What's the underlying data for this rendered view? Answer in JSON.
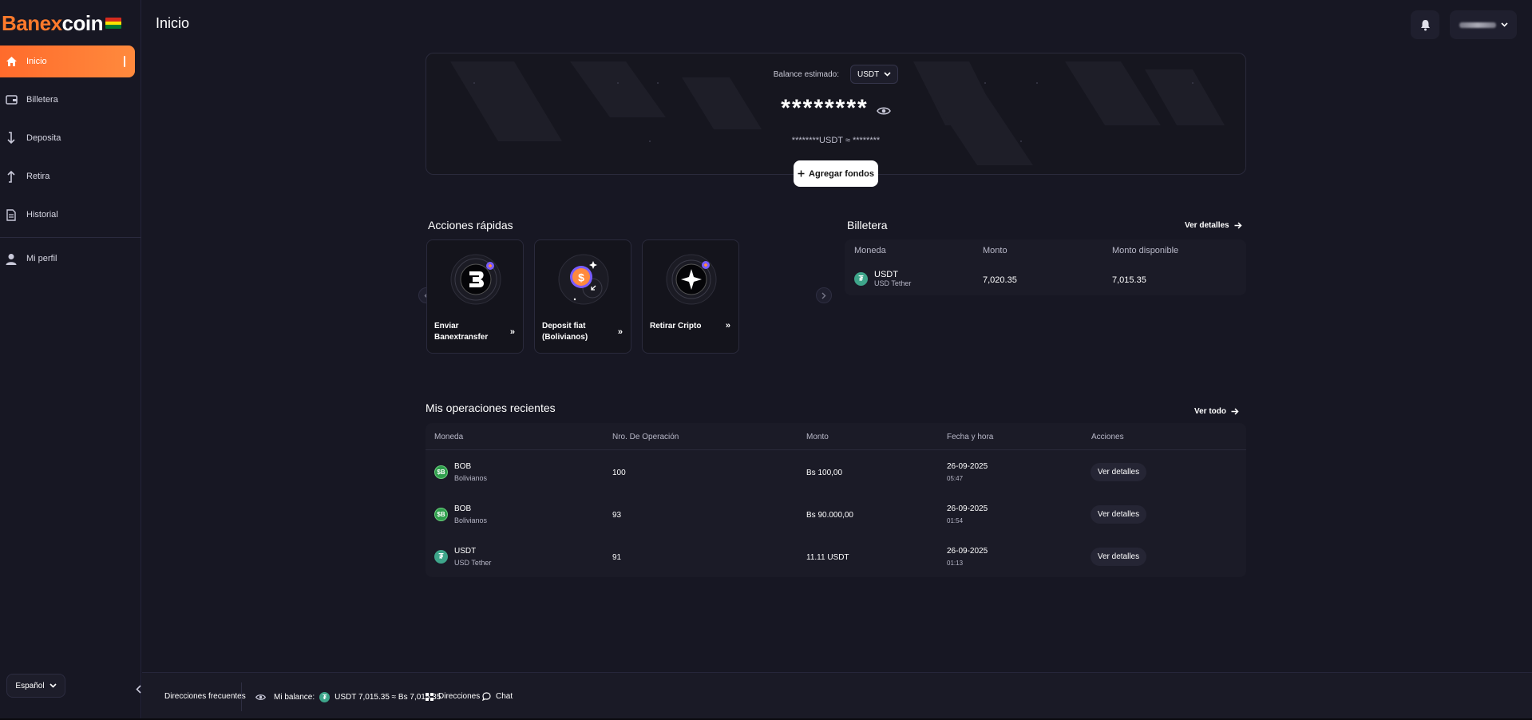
{
  "brand": {
    "name_orange": "Banex",
    "name_white": "coin",
    "colors": {
      "accent": "#ff7a2b",
      "flag": [
        "#d52b1e",
        "#f9e300",
        "#007934"
      ]
    }
  },
  "sidebar": {
    "items": [
      {
        "label": "Inicio",
        "icon": "home-icon",
        "active": true
      },
      {
        "label": "Billetera",
        "icon": "wallet-icon"
      },
      {
        "label": "Deposita",
        "icon": "arrow-down-icon"
      },
      {
        "label": "Retira",
        "icon": "arrow-up-icon"
      },
      {
        "label": "Historial",
        "icon": "document-icon"
      },
      {
        "label": "Mi perfil",
        "icon": "user-icon"
      }
    ],
    "language": "Español"
  },
  "header": {
    "title": "Inicio"
  },
  "balance": {
    "label": "Balance estimado:",
    "currency": "USDT",
    "amount": "********",
    "conversion": "********USDT ≈ ********",
    "add_funds": "Agregar fondos"
  },
  "quick_actions": {
    "title": "Acciones rápidas",
    "items": [
      {
        "label": "Enviar Banextransfer"
      },
      {
        "label": "Deposit fiat (Bolivianos)"
      },
      {
        "label": "Retirar Cripto"
      }
    ]
  },
  "wallet": {
    "title": "Billetera",
    "link": "Ver detalles",
    "headers": [
      "Moneda",
      "Monto",
      "Monto disponible"
    ],
    "rows": [
      {
        "coin": "USDT",
        "name": "USD Tether",
        "amount": "7,020.35",
        "available": "7,015.35"
      }
    ]
  },
  "recent_ops": {
    "title": "Mis operaciones recientes",
    "link": "Ver todo",
    "headers": [
      "Moneda",
      "Nro. De Operación",
      "Monto",
      "Fecha y hora",
      "Acciones"
    ],
    "rows": [
      {
        "coin": "BOB",
        "name": "Bolivianos",
        "op": "100",
        "amount": "Bs 100,00",
        "date": "26-09-2025",
        "time": "05:47",
        "action": "Ver detalles",
        "type": "bob"
      },
      {
        "coin": "BOB",
        "name": "Bolivianos",
        "op": "93",
        "amount": "Bs 90.000,00",
        "date": "26-09-2025",
        "time": "01:54",
        "action": "Ver detalles",
        "type": "bob"
      },
      {
        "coin": "USDT",
        "name": "USD Tether",
        "op": "91",
        "amount": "11.11 USDT",
        "date": "26-09-2025",
        "time": "01:13",
        "action": "Ver detalles",
        "type": "usdt"
      }
    ]
  },
  "footer": {
    "frequent": "Direcciones frecuentes",
    "balance_label": "Mi balance:",
    "balance_value": "USDT 7,015.35 ≈ Bs 7,015.35",
    "directions": "Direcciones",
    "chat": "Chat"
  }
}
